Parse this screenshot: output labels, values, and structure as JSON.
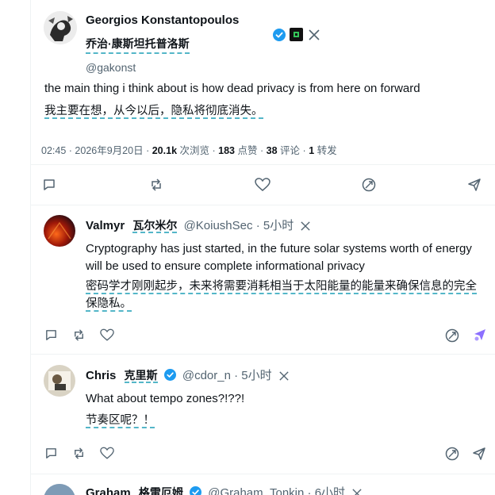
{
  "main_tweet": {
    "author_name": "Georgios Konstantopoulos",
    "author_name_translated": "乔治·康斯坦托普洛斯",
    "handle": "@gakonst",
    "text": "the main thing i think about is how dead privacy is from here on forward",
    "text_translated": "我主要在想，从今以后，隐私将彻底消失。",
    "time": "02:45",
    "date": "2026年9月20日",
    "views_value": "20.1k",
    "views_label": "次浏览",
    "likes_value": "183",
    "likes_label": "点赞",
    "comments_value": "38",
    "comments_label": "评论",
    "reposts_value": "1",
    "reposts_label": "转发",
    "separator": "·"
  },
  "replies": [
    {
      "name": "Valmyr",
      "name_translated": "瓦尔米尔",
      "handle": "@KoiushSec",
      "age": "5小时",
      "text": "Cryptography has just started, in the future solar systems worth of energy will be used to ensure complete informational privacy",
      "text_translated": "密码学才刚刚起步，未来将需要消耗相当于太阳能量的能量来确保信息的完全保隐私。"
    },
    {
      "name": "Chris",
      "name_translated": "克里斯",
      "handle": "@cdor_n",
      "age": "5小时",
      "text": "What about tempo zones?!??!",
      "text_translated": "节奏区呢？！"
    },
    {
      "name": "Graham",
      "name_translated": "格雷厄姆",
      "handle": "@Graham_Tonkin",
      "age": "6小时"
    }
  ],
  "colors": {
    "verified": "#1d9bf0",
    "muted": "#536471",
    "translation_underline": "#54b6c8",
    "grok_accent": "#7856ff"
  }
}
